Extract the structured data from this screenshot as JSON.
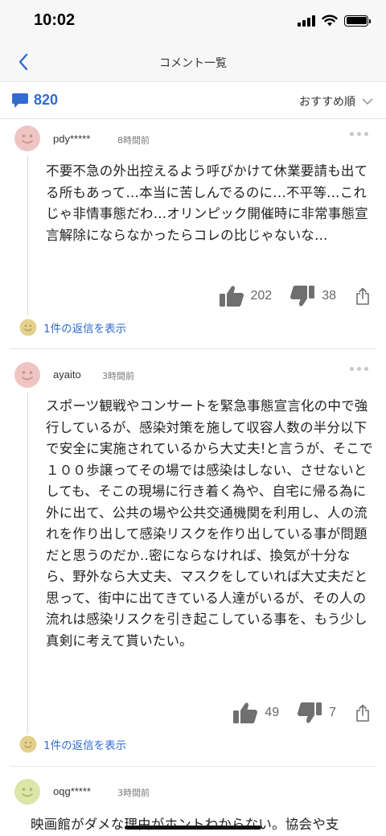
{
  "status": {
    "time": "10:02"
  },
  "nav": {
    "title": "コメント一覧"
  },
  "toolbar": {
    "count": "820",
    "sort_label": "おすすめ順"
  },
  "comments": [
    {
      "user": "pdy*****",
      "time": "8時間前",
      "text": "不要不急の外出控えるよう呼びかけて休業要請も出てる所もあって…本当に苦しんでるのに…不平等…これじゃ非情事態だわ…オリンピック開催時に非常事態宣言解除にならなかったらコレの比じゃないな…",
      "likes": "202",
      "dislikes": "38",
      "replies": "1件の返信を表示"
    },
    {
      "user": "ayaito",
      "time": "3時間前",
      "text": "スポーツ観戦やコンサートを緊急事態宣言化の中で強行しているが、感染対策を施して収容人数の半分以下で安全に実施されているから大丈夫!と言うが、そこで１００歩譲ってその場では感染はしない、させないとしても、そこの現場に行き着く為や、自宅に帰る為に外に出て、公共の場や公共交通機関を利用し、人の流れを作り出して感染リスクを作り出している事が問題だと思うのだか‥密にならなければ、換気が十分なら、野外なら大丈夫、マスクをしていれば大丈夫だと思って、街中に出てきている人達がいるが、その人の流れは感染リスクを引き起こしている事を、もう少し真剣に考えて貰いたい。",
      "likes": "49",
      "dislikes": "7",
      "replies": "1件の返信を表示"
    },
    {
      "user": "oqg*****",
      "time": "3時間前",
      "text": "映画館がダメな理由がホントわからない。協会や支"
    }
  ],
  "colors": {
    "accent": "#2f6bd1",
    "icon_gray": "#6f6f6f"
  }
}
